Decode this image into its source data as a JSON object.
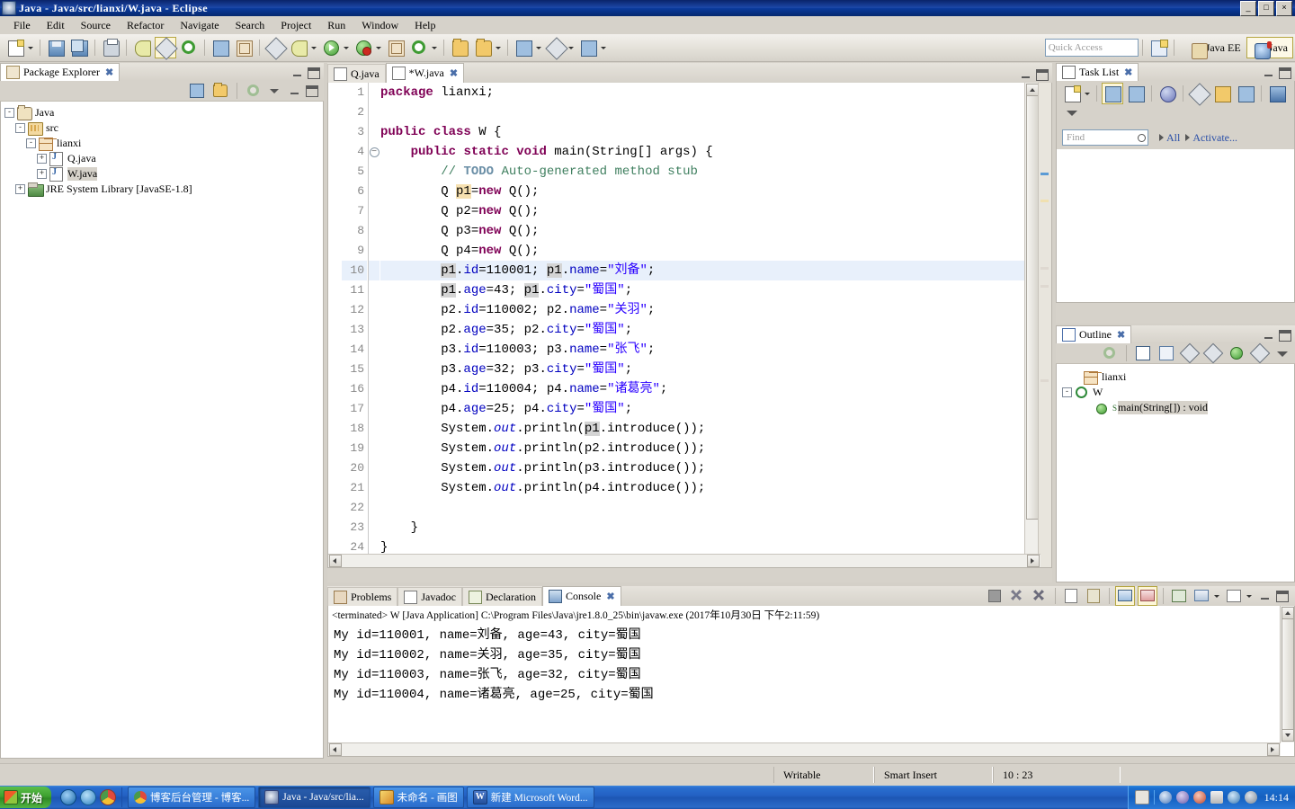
{
  "window": {
    "title": "Java - Java/src/lianxi/W.java - Eclipse",
    "icon": "eclipse-icon",
    "buttons": [
      {
        "name": "minimize-button",
        "glyph": "_"
      },
      {
        "name": "maximize-button",
        "glyph": "□"
      },
      {
        "name": "close-button",
        "glyph": "×"
      }
    ]
  },
  "menubar": {
    "items": [
      {
        "label": "File",
        "mnemonic": "F"
      },
      {
        "label": "Edit",
        "mnemonic": "E"
      },
      {
        "label": "Source",
        "mnemonic": "S"
      },
      {
        "label": "Refactor",
        "mnemonic": "t"
      },
      {
        "label": "Navigate",
        "mnemonic": "N"
      },
      {
        "label": "Search",
        "mnemonic": "a"
      },
      {
        "label": "Project",
        "mnemonic": "P"
      },
      {
        "label": "Run",
        "mnemonic": "R"
      },
      {
        "label": "Window",
        "mnemonic": "W"
      },
      {
        "label": "Help",
        "mnemonic": "H"
      }
    ]
  },
  "toolbar": {
    "quick_access_placeholder": "Quick Access",
    "perspectives": [
      {
        "label": "Java EE",
        "icon": "java-ee-perspective-icon",
        "active": false
      },
      {
        "label": "Java",
        "icon": "java-perspective-icon",
        "active": true
      }
    ],
    "buttons": [
      {
        "name": "new-button",
        "icon": "new-wizard-icon"
      },
      {
        "name": "save-button",
        "icon": "save-icon"
      },
      {
        "name": "save-all-button",
        "icon": "save-all-icon"
      },
      {
        "name": "print-button",
        "icon": "print-icon"
      },
      {
        "name": "debug-skip-button",
        "icon": "skip-breakpoints-icon"
      },
      {
        "name": "toggle-mark-occurrences-button",
        "icon": "mark-occurrences-icon"
      },
      {
        "name": "build-button",
        "icon": "build-icon"
      },
      {
        "name": "open-type-button",
        "icon": "open-type-icon"
      },
      {
        "name": "new-java-project-button",
        "icon": "new-java-project-icon"
      },
      {
        "name": "external-tools-button",
        "icon": "external-tools-icon"
      },
      {
        "name": "debug-button",
        "icon": "debug-icon"
      },
      {
        "name": "run-button",
        "icon": "run-icon"
      },
      {
        "name": "run-coverage-button",
        "icon": "coverage-icon"
      },
      {
        "name": "new-package-button",
        "icon": "new-package-icon"
      },
      {
        "name": "new-class-button",
        "icon": "new-class-icon"
      },
      {
        "name": "open-resource-button",
        "icon": "open-resource-icon"
      },
      {
        "name": "search-button",
        "icon": "search-icon"
      },
      {
        "name": "next-annotation-button",
        "icon": "next-annotation-icon"
      },
      {
        "name": "previous-annotation-button",
        "icon": "previous-annotation-icon"
      },
      {
        "name": "last-edit-location-button",
        "icon": "last-edit-icon"
      },
      {
        "name": "back-button",
        "icon": "back-icon"
      },
      {
        "name": "forward-button",
        "icon": "forward-icon"
      }
    ]
  },
  "package_explorer": {
    "title": "Package Explorer",
    "icon": "package-explorer-icon",
    "toolbar": [
      {
        "name": "collapse-all-button",
        "icon": "collapse-all-icon"
      },
      {
        "name": "link-with-editor-button",
        "icon": "link-editor-icon"
      },
      {
        "name": "focus-on-active-task-button",
        "icon": "focus-task-icon"
      },
      {
        "name": "view-menu-button",
        "icon": "view-menu-icon"
      },
      {
        "name": "minimize-button",
        "icon": "minimize-icon"
      },
      {
        "name": "maximize-button",
        "icon": "maximize-icon"
      }
    ],
    "tree": [
      {
        "label": "Java",
        "icon": "project-icon",
        "indent": 0,
        "expander": "-",
        "selected": false
      },
      {
        "label": "src",
        "icon": "source-folder-icon",
        "indent": 1,
        "expander": "-",
        "selected": false
      },
      {
        "label": "lianxi",
        "icon": "package-icon",
        "indent": 2,
        "expander": "-",
        "selected": false
      },
      {
        "label": "Q.java",
        "icon": "java-file-icon",
        "indent": 3,
        "expander": "+",
        "selected": false
      },
      {
        "label": "W.java",
        "icon": "java-file-icon",
        "indent": 3,
        "expander": "+",
        "selected": true
      },
      {
        "label": "JRE System Library [JavaSE-1.8]",
        "icon": "jre-library-icon",
        "indent": 1,
        "expander": "+",
        "selected": false
      }
    ]
  },
  "editor": {
    "tabs": [
      {
        "label": "Q.java",
        "icon": "java-file-icon",
        "active": false,
        "closable": false
      },
      {
        "label": "*W.java",
        "icon": "java-file-icon",
        "active": true,
        "closable": true
      }
    ],
    "current_line": 10,
    "lines": [
      {
        "n": 1,
        "fold": "",
        "html": "<span class=\"kw\">package</span> lianxi;"
      },
      {
        "n": 2,
        "fold": "",
        "html": ""
      },
      {
        "n": 3,
        "fold": "",
        "html": "<span class=\"kw\">public</span> <span class=\"kw\">class</span> W {"
      },
      {
        "n": 4,
        "fold": "-",
        "html": "    <span class=\"kw\">public</span> <span class=\"kw\">static</span> <span class=\"kw\">void</span> main(String[] args) {"
      },
      {
        "n": 5,
        "fold": "",
        "html": "        <span class=\"cm\">// </span><span class=\"cm-todo\">TODO</span><span class=\"cm\"> Auto-generated method stub</span>"
      },
      {
        "n": 6,
        "fold": "",
        "html": "        Q <span class=\"hlo\">p1</span>=<span class=\"kw\">new</span> Q();"
      },
      {
        "n": 7,
        "fold": "",
        "html": "        Q p2=<span class=\"kw\">new</span> Q();"
      },
      {
        "n": 8,
        "fold": "",
        "html": "        Q p3=<span class=\"kw\">new</span> Q();"
      },
      {
        "n": 9,
        "fold": "",
        "html": "        Q p4=<span class=\"kw\">new</span> Q();"
      },
      {
        "n": 10,
        "fold": "",
        "html": "        <span class=\"hl\">p1</span>.<span class=\"fld\">id</span>=110001; <span class=\"hl\">p1</span>.<span class=\"fld\">name</span>=<span class=\"str\">\"刘备\"</span>;"
      },
      {
        "n": 11,
        "fold": "",
        "html": "        <span class=\"hl\">p1</span>.<span class=\"fld\">age</span>=43; <span class=\"hl\">p1</span>.<span class=\"fld\">city</span>=<span class=\"str\">\"蜀国\"</span>;"
      },
      {
        "n": 12,
        "fold": "",
        "html": "        p2.<span class=\"fld\">id</span>=110002; p2.<span class=\"fld\">name</span>=<span class=\"str\">\"关羽\"</span>;"
      },
      {
        "n": 13,
        "fold": "",
        "html": "        p2.<span class=\"fld\">age</span>=35; p2.<span class=\"fld\">city</span>=<span class=\"str\">\"蜀国\"</span>;"
      },
      {
        "n": 14,
        "fold": "",
        "html": "        p3.<span class=\"fld\">id</span>=110003; p3.<span class=\"fld\">name</span>=<span class=\"str\">\"张飞\"</span>;"
      },
      {
        "n": 15,
        "fold": "",
        "html": "        p3.<span class=\"fld\">age</span>=32; p3.<span class=\"fld\">city</span>=<span class=\"str\">\"蜀国\"</span>;"
      },
      {
        "n": 16,
        "fold": "",
        "html": "        p4.<span class=\"fld\">id</span>=110004; p4.<span class=\"fld\">name</span>=<span class=\"str\">\"诸葛亮\"</span>;"
      },
      {
        "n": 17,
        "fold": "",
        "html": "        p4.<span class=\"fld\">age</span>=25; p4.<span class=\"fld\">city</span>=<span class=\"str\">\"蜀国\"</span>;"
      },
      {
        "n": 18,
        "fold": "",
        "html": "        System.<span class=\"sfld\">out</span>.println(<span class=\"hl\">p1</span>.introduce());"
      },
      {
        "n": 19,
        "fold": "",
        "html": "        System.<span class=\"sfld\">out</span>.println(p2.introduce());"
      },
      {
        "n": 20,
        "fold": "",
        "html": "        System.<span class=\"sfld\">out</span>.println(p3.introduce());"
      },
      {
        "n": 21,
        "fold": "",
        "html": "        System.<span class=\"sfld\">out</span>.println(p4.introduce());"
      },
      {
        "n": 22,
        "fold": "",
        "html": ""
      },
      {
        "n": 23,
        "fold": "",
        "html": "    }"
      },
      {
        "n": 24,
        "fold": "",
        "html": "}"
      }
    ]
  },
  "task_list": {
    "title": "Task List",
    "icon": "task-list-icon",
    "find_placeholder": "Find",
    "filter_all": "All",
    "filter_activate": "Activate...",
    "toolbar": [
      {
        "name": "new-task-button",
        "icon": "new-task-icon"
      },
      {
        "name": "categorized-presentation-button",
        "icon": "categorized-icon"
      },
      {
        "name": "scheduled-presentation-button",
        "icon": "scheduled-icon"
      },
      {
        "name": "synchronize-button",
        "icon": "synchronize-icon"
      },
      {
        "name": "focus-on-workweek-button",
        "icon": "workweek-icon"
      },
      {
        "name": "collapse-all-button",
        "icon": "collapse-all-icon"
      },
      {
        "name": "restore-task-button",
        "icon": "restore-task-icon"
      },
      {
        "name": "view-menu-button",
        "icon": "view-menu-icon"
      }
    ]
  },
  "outline": {
    "title": "Outline",
    "icon": "outline-icon",
    "toolbar": [
      {
        "name": "focus-active-task-button",
        "icon": "focus-task-icon"
      },
      {
        "name": "collapse-all-button",
        "icon": "collapse-all-icon"
      },
      {
        "name": "sort-button",
        "icon": "sort-az-icon"
      },
      {
        "name": "hide-fields-button",
        "icon": "hide-fields-icon"
      },
      {
        "name": "hide-static-button",
        "icon": "hide-static-icon"
      },
      {
        "name": "hide-non-public-button",
        "icon": "hide-nonpublic-icon"
      },
      {
        "name": "hide-local-types-button",
        "icon": "hide-local-icon"
      },
      {
        "name": "view-menu-button",
        "icon": "view-menu-icon"
      }
    ],
    "items": [
      {
        "label": "lianxi",
        "icon": "package-icon",
        "indent": 1,
        "expander": "",
        "selected": false
      },
      {
        "label": "W",
        "icon": "class-icon",
        "indent": 0,
        "expander": "-",
        "selected": false
      },
      {
        "label": "main(String[]) : void",
        "icon": "public-method-icon",
        "indent": 2,
        "expander": "",
        "selected": true,
        "modifier": "S"
      }
    ]
  },
  "bottom_panel": {
    "tabs": [
      {
        "label": "Problems",
        "icon": "problems-icon",
        "active": false,
        "closable": false
      },
      {
        "label": "Javadoc",
        "icon": "javadoc-icon",
        "active": false,
        "closable": false
      },
      {
        "label": "Declaration",
        "icon": "declaration-icon",
        "active": false,
        "closable": false
      },
      {
        "label": "Console",
        "icon": "console-icon",
        "active": true,
        "closable": true
      }
    ],
    "toolbar": [
      {
        "name": "terminate-button",
        "icon": "terminate-icon"
      },
      {
        "name": "remove-launch-button",
        "icon": "remove-launch-icon"
      },
      {
        "name": "remove-all-terminated-button",
        "icon": "remove-all-icon"
      },
      {
        "name": "clear-console-button",
        "icon": "clear-console-icon"
      },
      {
        "name": "scroll-lock-button",
        "icon": "scroll-lock-icon"
      },
      {
        "name": "show-console-on-output-button",
        "icon": "show-on-output-icon"
      },
      {
        "name": "show-console-on-error-button",
        "icon": "show-on-error-icon"
      },
      {
        "name": "pin-console-button",
        "icon": "pin-console-icon"
      },
      {
        "name": "display-selected-console-button",
        "icon": "display-console-icon"
      },
      {
        "name": "open-console-button",
        "icon": "open-console-icon"
      },
      {
        "name": "minimize-button",
        "icon": "minimize-icon"
      },
      {
        "name": "maximize-button",
        "icon": "maximize-icon"
      }
    ],
    "console": {
      "header": "<terminated> W [Java Application] C:\\Program Files\\Java\\jre1.8.0_25\\bin\\javaw.exe  (2017年10月30日 下午2:11:59)",
      "output": [
        "My id=110001, name=刘备, age=43, city=蜀国",
        "My id=110002, name=关羽, age=35, city=蜀国",
        "My id=110003, name=张飞, age=32, city=蜀国",
        "My id=110004, name=诸葛亮, age=25, city=蜀国"
      ]
    }
  },
  "statusbar": {
    "writable": "Writable",
    "insert_mode": "Smart Insert",
    "position": "10 : 23"
  },
  "taskbar": {
    "start_label": "开始",
    "quick_launch": [
      {
        "name": "ie-quicklaunch-icon",
        "color": "#1e88d8"
      },
      {
        "name": "browser2-quicklaunch-icon",
        "color": "#3aa0e0"
      },
      {
        "name": "chrome-quicklaunch-icon",
        "color": "#e04a3c"
      }
    ],
    "tasks": [
      {
        "label": "博客后台管理 - 博客...",
        "icon": "browser-window-icon",
        "active": false
      },
      {
        "label": "Java - Java/src/lia...",
        "icon": "eclipse-window-icon",
        "active": true
      },
      {
        "label": "未命名 - 画图",
        "icon": "paint-window-icon",
        "active": false
      },
      {
        "label": "新建 Microsoft Word...",
        "icon": "word-window-icon",
        "active": false
      }
    ],
    "tray": {
      "icons": [
        {
          "name": "keyboard-layout-icon",
          "color": "#e8e4dc"
        },
        {
          "name": "system-icon-1",
          "color": "#6fa8d8"
        },
        {
          "name": "system-icon-2",
          "color": "#8f7fd8"
        },
        {
          "name": "volume-icon",
          "color": "#d85a3a"
        },
        {
          "name": "network-icon",
          "color": "#cfcfcf"
        },
        {
          "name": "shield-icon",
          "color": "#5aa0d8"
        },
        {
          "name": "update-icon",
          "color": "#9aa8b8"
        }
      ],
      "clock": "14:14"
    }
  },
  "colors": {
    "title_blue": "#0a246a",
    "chrome": "#d6d2ca",
    "panel_bg": "#ffffff",
    "keyword": "#7f0055",
    "string": "#2a00ff",
    "comment": "#3f7f5f",
    "field": "#0000c0",
    "current_line": "#e8f0fb",
    "occurrence": "#d4d4d4",
    "taskbar_blue": "#2361c4"
  }
}
